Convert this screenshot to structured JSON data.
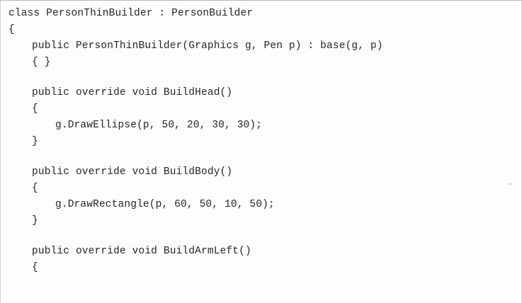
{
  "code": {
    "line_01": "class PersonThinBuilder : PersonBuilder",
    "line_02": "{",
    "line_03": "public PersonThinBuilder(Graphics g, Pen p) : base(g, p)",
    "line_04": "{ }",
    "line_05": "public override void BuildHead()",
    "line_06": "{",
    "line_07": "g.DrawEllipse(p, 50, 20, 30, 30);",
    "line_08": "}",
    "line_09": "public override void BuildBody()",
    "line_10": "{",
    "line_11": "g.DrawRectangle(p, 60, 50, 10, 50);",
    "line_12": "}",
    "line_13": "public override void BuildArmLeft()",
    "line_14": "{"
  }
}
